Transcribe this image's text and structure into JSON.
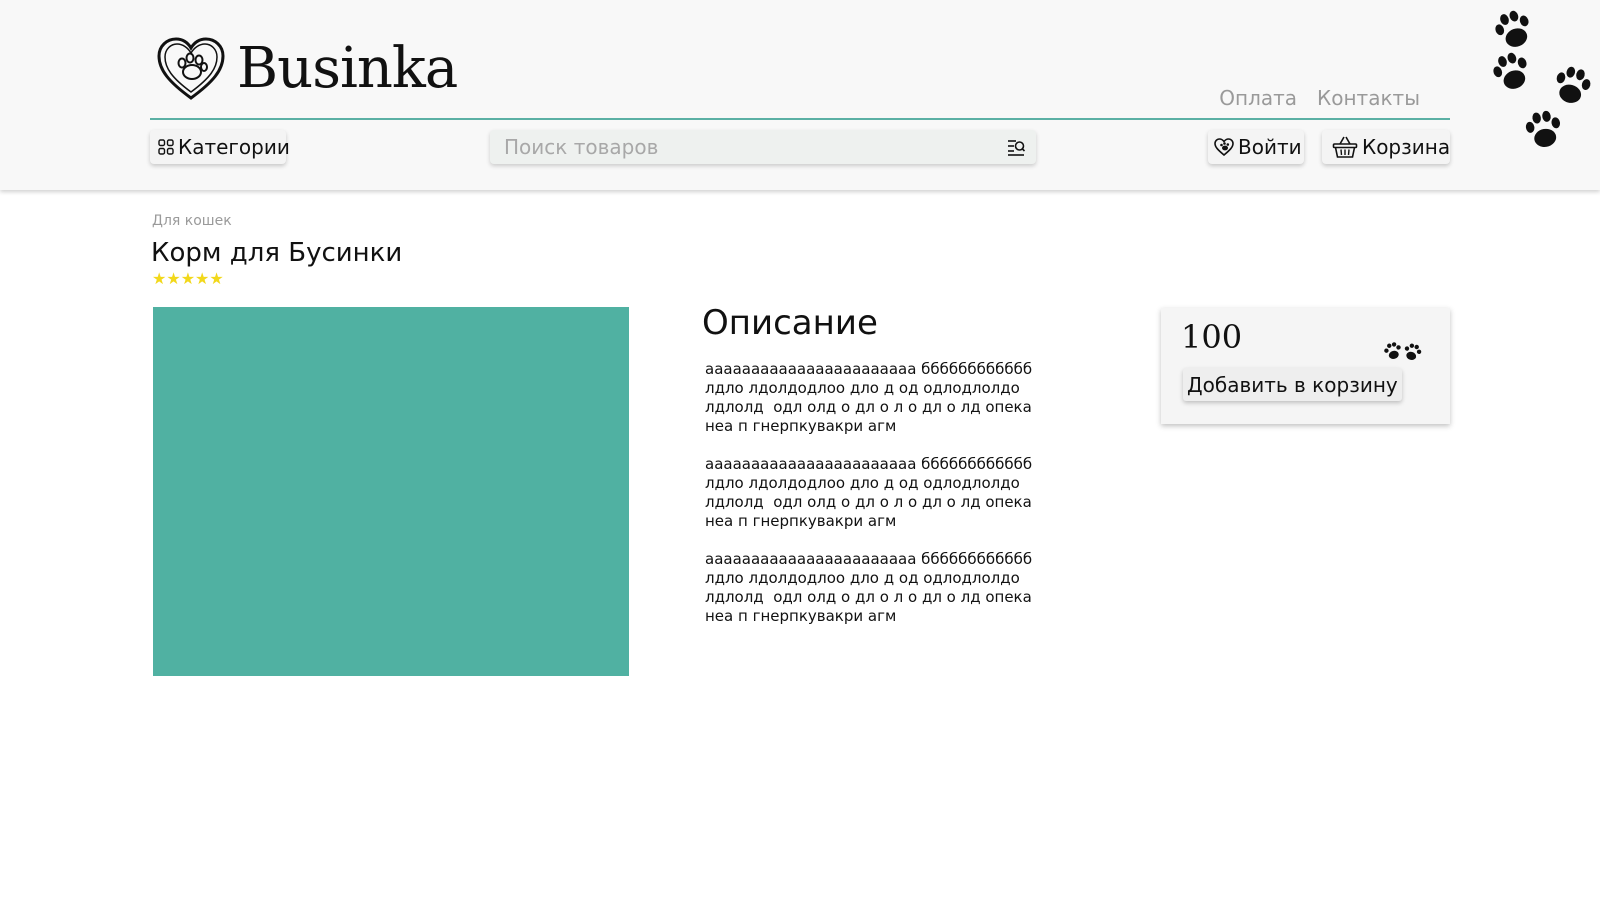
{
  "header": {
    "logo_text": "Businka",
    "links": [
      "Оплата",
      "Контакты"
    ],
    "categories_label": "Категории",
    "search_placeholder": "Поиск товаров",
    "login_label": "Войти",
    "cart_label": "Корзина",
    "accent_color": "#5bb0a4"
  },
  "product": {
    "breadcrumb": "Для кошек",
    "title": "Корм для Бусинки",
    "rating": 5,
    "stars": "★★★★★",
    "image_color": "#50b1a2",
    "description_heading": "Описание",
    "description_paragraphs": [
      "ааааааааааааааааааааааа бббббббббббб лдло лдолдодлоо дло д од одлодлолдо лдлолд  одл олд о дл о л о дл о лд опека неа п гнерпкувакри агм",
      "ааааааааааааааааааааааа бббббббббббб лдло лдолдодлоо дло д од одлодлолдо лдлолд  одл олд о дл о л о дл о лд опека неа п гнерпкувакри агм",
      "ааааааааааааааааааааааа бббббббббббб лдло лдолдодлоо дло д од одлодлолдо лдлолд  одл олд о дл о л о дл о лд опека неа п гнерпкувакри агм"
    ],
    "price": "100",
    "add_to_cart_label": "Добавить в корзину"
  },
  "icons": {
    "logo": "heart-paw-icon",
    "categories": "grid-icon",
    "search": "search-list-icon",
    "login": "heart-paw-icon",
    "cart": "basket-icon",
    "currency": "paws-icon",
    "decor": "paw-print-icon"
  }
}
